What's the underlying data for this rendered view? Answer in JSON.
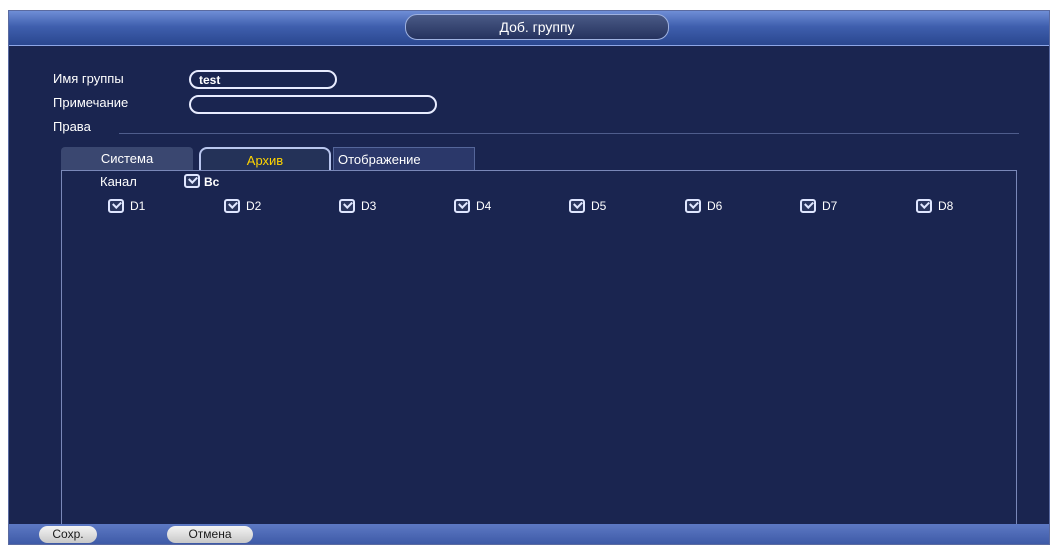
{
  "window": {
    "title": "Доб. группу"
  },
  "form": {
    "group_name_label": "Имя группы",
    "group_name_value": "test",
    "note_label": "Примечание",
    "note_value": "",
    "rights_label": "Права"
  },
  "tabs": [
    {
      "label": "Система",
      "active": false
    },
    {
      "label": "Архив",
      "active": true
    },
    {
      "label": "Отображение",
      "active": false
    }
  ],
  "panel": {
    "channel_label": "Канал",
    "all_label": "Вс",
    "channels": [
      {
        "label": "D1",
        "checked": true
      },
      {
        "label": "D2",
        "checked": true
      },
      {
        "label": "D3",
        "checked": true
      },
      {
        "label": "D4",
        "checked": true
      },
      {
        "label": "D5",
        "checked": true
      },
      {
        "label": "D6",
        "checked": true
      },
      {
        "label": "D7",
        "checked": true
      },
      {
        "label": "D8",
        "checked": true
      }
    ]
  },
  "buttons": {
    "save": "Сохр.",
    "cancel": "Отмена"
  },
  "colors": {
    "background": "#1a2550",
    "accent": "#ffd400",
    "bar": "#3e5aa7"
  }
}
